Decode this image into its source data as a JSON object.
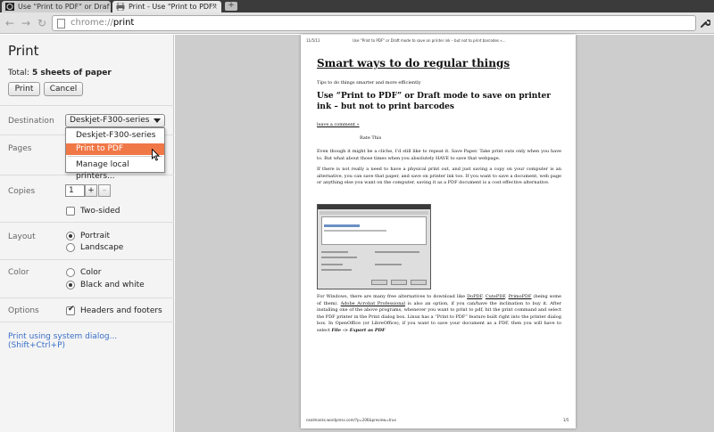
{
  "browser": {
    "tabs": [
      {
        "title": "Use \"Print to PDF\" or Draf",
        "active": false
      },
      {
        "title": "Print - Use \"Print to PDF\"",
        "active": true
      }
    ],
    "new_tab_label": "+",
    "url_scheme": "chrome://",
    "url_host": "print",
    "back_glyph": "←",
    "forward_glyph": "→",
    "reload_glyph": "↻",
    "close_glyph": "×"
  },
  "sidebar": {
    "title": "Print",
    "total_label": "Total:",
    "total_value": "5 sheets of paper",
    "print_button": "Print",
    "cancel_button": "Cancel",
    "destination": {
      "label": "Destination",
      "selected": "Deskjet-F300-series",
      "options": [
        "Deskjet-F300-series",
        "Print to PDF",
        "Manage local printers..."
      ],
      "highlighted": "Print to PDF"
    },
    "pages": {
      "label": "Pages"
    },
    "copies": {
      "label": "Copies",
      "value": "1",
      "increment": "+",
      "decrement": "–",
      "two_sided_label": "Two-sided",
      "two_sided_checked": false
    },
    "layout": {
      "label": "Layout",
      "portrait": "Portrait",
      "landscape": "Landscape",
      "selected": "Portrait"
    },
    "color": {
      "label": "Color",
      "color_option": "Color",
      "bw_option": "Black and white",
      "selected": "Black and white"
    },
    "options": {
      "label": "Options",
      "headers_footers": "Headers and footers",
      "headers_footers_checked": true
    },
    "system_dialog_link": "Print using system dialog... (Shift+Ctrl+P)"
  },
  "preview": {
    "header_date": "11/5/11",
    "header_title": "Use \"Print to PDF\" or Draft mode to save on printer ink – but not to print barcodes «...",
    "site_title": "Smart ways to do regular things",
    "tagline": "Tips to do things smarter and more efficiently",
    "post_title": "Use “Print to PDF” or Draft mode to save on printer ink – but not to print barcodes",
    "leave_comment": "leave a comment »",
    "rate_this": "Rate This",
    "para1": "Even though it might be a cliche, I’d still like to repeat it. Save Paper. Take print outs only when you have to. But what about those times when you absolutely HAVE to save that webpage.",
    "para2": "If there is not really a need to have a physical print out, and just saving a copy on your computer is an alternative, you can save that paper, and  save on printer ink too. If you want to save a document, web page or anything else you want on the computer, saving it as a PDF document is a cost effective alternative.",
    "para3_start": "For Windows, there are many free alternatives to download like ",
    "link_dopdf": "DoPDF",
    "link_cutepdf": "CutePDF",
    "link_primopdf": "PrimoPDF",
    "para3_mid": " (being some of them). ",
    "link_acrobat": "Adobe Acrobat Professional",
    "para3_end": " is also an option, if you can/have the inclination to buy it. After installing one of the above programs, whenever you want to print to pdf, hit the print command and select the PDF printer in the Print dialog box. Linux has a “Print to PDF” feature built right into the printer dialog box. In OpenOffice (or LibreOffice), if you want to save your document as a PDF, then you will have to select ",
    "para3_em": "File -> Export as PDF",
    "footer_url": "nealmonks.wordpress.com/?p=206&preview=true",
    "footer_page": "1/5"
  },
  "colors": {
    "accent_link": "#3a6fc7",
    "dropdown_highlight": "#f07746"
  }
}
